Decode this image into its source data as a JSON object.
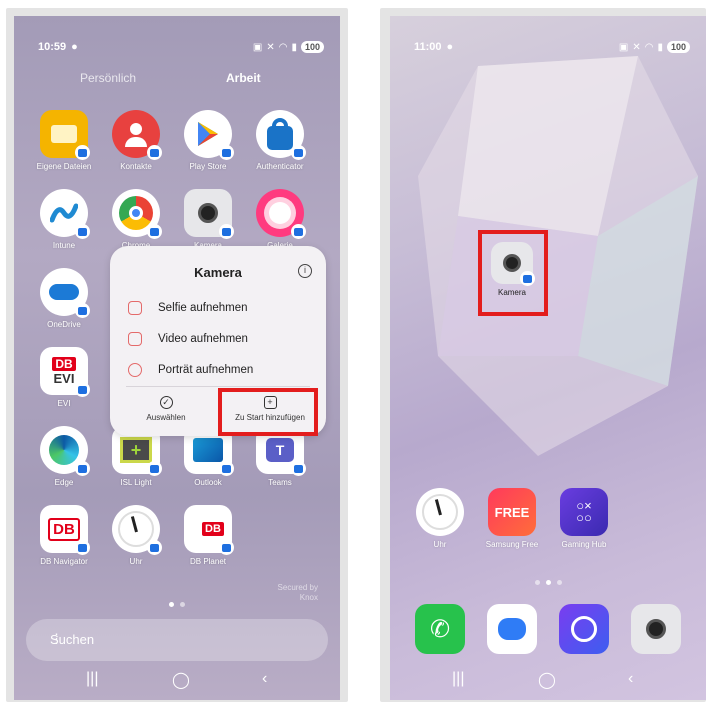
{
  "left": {
    "status": {
      "time": "10:59",
      "battery": "100"
    },
    "tabs": {
      "personal": "Persönlich",
      "work": "Arbeit"
    },
    "apps": [
      {
        "label": "Eigene Dateien",
        "color": "#f5b400",
        "icon": "folder-icon"
      },
      {
        "label": "Kontakte",
        "color": "#e8413f",
        "icon": "contacts-icon"
      },
      {
        "label": "Play Store",
        "color": "#ffffff",
        "icon": "play-store-icon"
      },
      {
        "label": "Authenticator",
        "color": "#ffffff",
        "icon": "authenticator-icon"
      },
      {
        "label": "Intune",
        "color": "#ffffff",
        "icon": "intune-icon"
      },
      {
        "label": "Chrome",
        "color": "#ffffff",
        "icon": "chrome-icon"
      },
      {
        "label": "Kamera",
        "color": "#e7e7ea",
        "icon": "camera-icon"
      },
      {
        "label": "Galerie",
        "color": "#ff3b7f",
        "icon": "gallery-icon"
      },
      {
        "label": "OneDrive",
        "color": "#ffffff",
        "icon": "onedrive-icon"
      },
      {
        "label": "EVI",
        "color": "#ffffff",
        "icon": "db-evi-icon"
      },
      {
        "label": "Edge",
        "color": "#ffffff",
        "icon": "edge-icon"
      },
      {
        "label": "ISL Light",
        "color": "#ffffff",
        "icon": "isl-light-icon"
      },
      {
        "label": "Outlook",
        "color": "#ffffff",
        "icon": "outlook-icon"
      },
      {
        "label": "Teams",
        "color": "#ffffff",
        "icon": "teams-icon"
      },
      {
        "label": "DB Navigator",
        "color": "#ffffff",
        "icon": "db-navigator-icon"
      },
      {
        "label": "Uhr",
        "color": "#ffffff",
        "icon": "clock-icon"
      },
      {
        "label": "DB Planet",
        "color": "#ffffff",
        "icon": "db-planet-icon"
      }
    ],
    "popup": {
      "title": "Kamera",
      "items": [
        {
          "label": "Selfie aufnehmen",
          "icon": "selfie-camera-icon"
        },
        {
          "label": "Video aufnehmen",
          "icon": "video-camera-icon"
        },
        {
          "label": "Porträt aufnehmen",
          "icon": "portrait-icon"
        }
      ],
      "select_label": "Auswählen",
      "add_home_label": "Zu Start hinzufügen"
    },
    "knox_line1": "Secured by",
    "knox_line2": "Knox",
    "search_placeholder": "Suchen"
  },
  "right": {
    "status": {
      "time": "11:00",
      "battery": "100"
    },
    "camera_label": "Kamera",
    "apps": [
      {
        "label": "Uhr",
        "icon": "clock-icon"
      },
      {
        "label": "Samsung Free",
        "icon": "samsung-free-icon"
      },
      {
        "label": "Gaming Hub",
        "icon": "gaming-hub-icon"
      }
    ],
    "free_text": "FREE",
    "dock": [
      "phone-icon",
      "messages-icon",
      "internet-icon",
      "camera-icon"
    ]
  },
  "colors": {
    "highlight": "#e31d1d",
    "badge": "#1e6fe0"
  }
}
